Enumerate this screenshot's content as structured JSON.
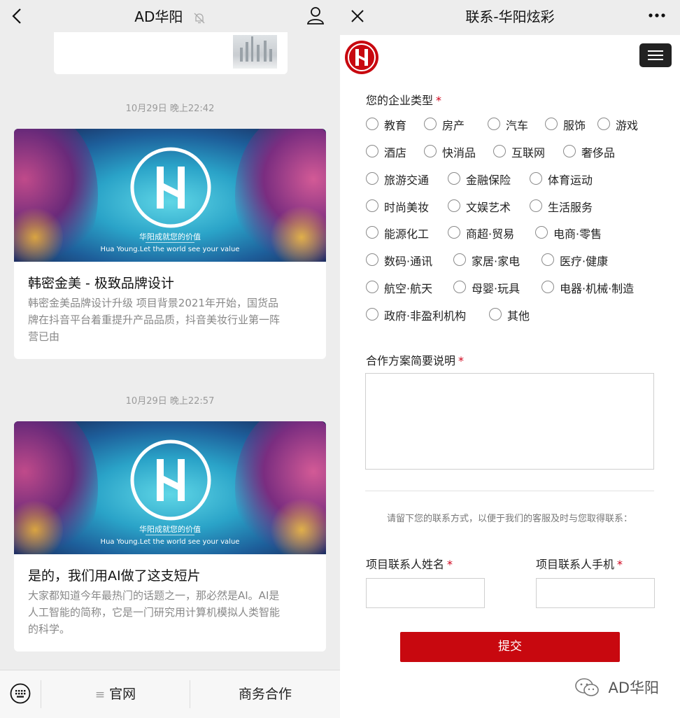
{
  "left_panel": {
    "title": "AD华阳",
    "icons": [
      "back-arrow-icon",
      "bell-muted-icon",
      "profile-icon"
    ],
    "messages": [
      {
        "time": "10月29日 晚上22:42",
        "title": "韩密金美 - 极致品牌设计",
        "desc_lines": [
          "韩密金美品牌设计升级  项目背景2021年开始，国货品",
          "牌在抖音平台着重提升产品品质，抖音美妆行业第一阵",
          "营已由"
        ],
        "banner_slogan_cn": "华阳成就您的价值",
        "banner_slogan_en": "Hua Young.Let the world see your value"
      },
      {
        "time": "10月29日 晚上22:57",
        "title": "是的，我们用AI做了这支短片",
        "desc_lines": [
          "大家都知道今年最热门的话题之一，那必然是AI。AI是",
          "人工智能的简称，它是一门研究用计算机模拟人类智能",
          "的科学。"
        ],
        "banner_slogan_cn": "华阳成就您的价值",
        "banner_slogan_en": "Hua Young.Let the world see your value"
      }
    ],
    "bottom_menu": {
      "keyboard_icon": "keyboard-icon",
      "menu_icon_glyph": "≡",
      "item1": "官网",
      "item2": "商务合作"
    }
  },
  "right_panel": {
    "title": "联系-华阳炫彩",
    "business_type_label": "您的企业类型",
    "required_mark": "*",
    "options": [
      [
        "教育",
        "房产",
        "汽车",
        "服饰",
        "游戏"
      ],
      [
        "酒店",
        "快消品",
        "互联网",
        "奢侈品"
      ],
      [
        "旅游交通",
        "金融保险",
        "体育运动"
      ],
      [
        "时尚美妆",
        "文娱艺术",
        "生活服务"
      ],
      [
        "能源化工",
        "商超·贸易",
        "电商·零售"
      ],
      [
        "数码·通讯",
        "家居·家电",
        "医疗·健康"
      ],
      [
        "航空·航天",
        "母婴·玩具",
        "电器·机械·制造"
      ],
      [
        "政府·非盈利机构",
        "其他"
      ]
    ],
    "plan_label": "合作方案简要说明",
    "contact_hint": "请留下您的联系方式，以便于我们的客服及时与您取得联系：",
    "name_label": "项目联系人姓名",
    "phone_label": "项目联系人手机",
    "submit_label": "提交",
    "watermark": "AD华阳",
    "brand_color": "#c8080f"
  }
}
